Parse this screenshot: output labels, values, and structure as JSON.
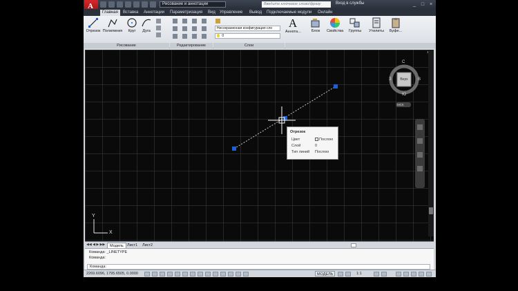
{
  "app": {
    "logo_letter": "A",
    "workspace": "Рисование и аннотации",
    "search_placeholder": "Введите ключевое слово/фразу",
    "signin": "Вход в службы",
    "window_controls": [
      "_",
      "□",
      "×"
    ]
  },
  "tabs": [
    "Главная",
    "Вставка",
    "Аннотации",
    "Параметризация",
    "Вид",
    "Управление",
    "Вывод",
    "Подключаемые модули",
    "Онлайн"
  ],
  "ribbon": {
    "draw_tools": [
      "Отрезок",
      "Полилиния",
      "Круг",
      "Дуга"
    ],
    "panels": [
      "Рисование",
      "Редактирование",
      "Слои"
    ],
    "layer_state": "Несохраненная конфигурация сло",
    "layer_current": "0",
    "big_tools": [
      "Аннота...",
      "Блок",
      "Свойства",
      "Группы",
      "Утилиты",
      "Буфе..."
    ]
  },
  "canvas": {
    "viewcube": {
      "north": "С",
      "south": "Ю",
      "west": "З",
      "east": "В",
      "face": "Верх",
      "wcs": "МСК"
    },
    "ucs_x": "X",
    "ucs_y": "Y"
  },
  "tooltip": {
    "title": "Отрезок",
    "rows": [
      {
        "key": "Цвет",
        "value": "Послою",
        "swatch": true
      },
      {
        "key": "Слой",
        "value": "0"
      },
      {
        "key": "Тип линий",
        "value": "Послою"
      }
    ]
  },
  "layout_tabs": [
    "Модель",
    "Лист1",
    "Лист2"
  ],
  "command": {
    "history": [
      "Команда:  _LINETYPE",
      "Команда:"
    ],
    "prompt": "Команда:"
  },
  "status": {
    "coords": "2269.6096, 1795.6505, 0.0000",
    "model": "МОДЕЛЬ",
    "scale": "1:1"
  },
  "colors": {
    "line": "#c8c8c8",
    "grip": "#1e5fd8",
    "accent": "#d8262b"
  }
}
